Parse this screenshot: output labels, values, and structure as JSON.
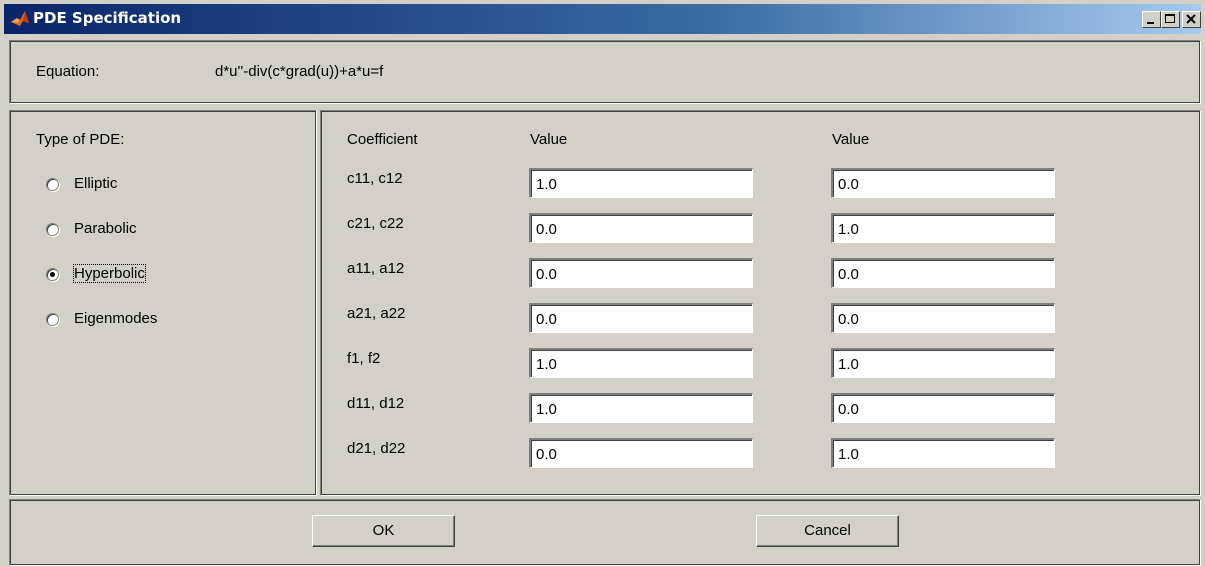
{
  "window": {
    "title": "PDE Specification"
  },
  "equation": {
    "label": "Equation:",
    "value": "d*u''-div(c*grad(u))+a*u=f"
  },
  "pde_type": {
    "label": "Type of PDE:",
    "options": [
      {
        "label": "Elliptic",
        "selected": false
      },
      {
        "label": "Parabolic",
        "selected": false
      },
      {
        "label": "Hyperbolic",
        "selected": true
      },
      {
        "label": "Eigenmodes",
        "selected": false
      }
    ]
  },
  "coefficients": {
    "header_coefficient": "Coefficient",
    "header_value1": "Value",
    "header_value2": "Value",
    "rows": [
      {
        "name": "c11, c12",
        "v1": "1.0",
        "v2": "0.0"
      },
      {
        "name": "c21, c22",
        "v1": "0.0",
        "v2": "1.0"
      },
      {
        "name": "a11, a12",
        "v1": "0.0",
        "v2": "0.0"
      },
      {
        "name": "a21, a22",
        "v1": "0.0",
        "v2": "0.0"
      },
      {
        "name": "f1, f2",
        "v1": "1.0",
        "v2": "1.0"
      },
      {
        "name": "d11, d12",
        "v1": "1.0",
        "v2": "0.0"
      },
      {
        "name": "d21, d22",
        "v1": "0.0",
        "v2": "1.0"
      }
    ]
  },
  "buttons": {
    "ok": "OK",
    "cancel": "Cancel"
  }
}
